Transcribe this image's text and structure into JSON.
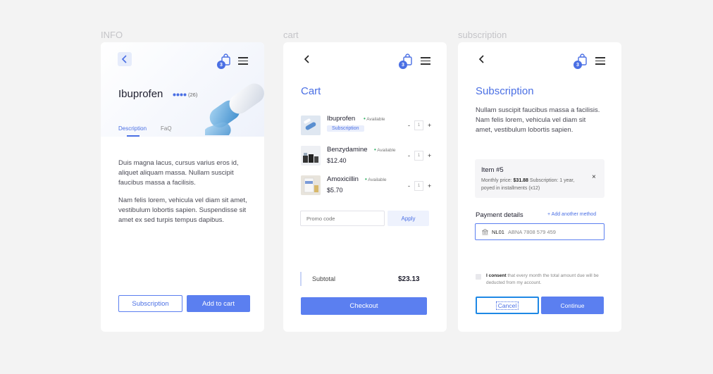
{
  "frames": {
    "info": "INFO",
    "cart": "cart",
    "subscription": "subscription"
  },
  "cart_badge_count": "3",
  "info": {
    "product_name": "Ibuprofen",
    "rating_count": "(26)",
    "tabs": [
      {
        "label": "Description"
      },
      {
        "label": "FaQ"
      }
    ],
    "description_p1": "Duis magna lacus, cursus varius eros id, aliquet aliquam massa. Nullam suscipit faucibus massa a facilisis.",
    "description_p2": "Nam felis lorem, vehicula vel diam sit amet, vestibulum lobortis sapien. Suspendisse sit amet ex sed turpis tempus dapibus.",
    "subscription_button": "Subscription",
    "add_to_cart_button": "Add to cart"
  },
  "cart": {
    "title": "Cart",
    "items": [
      {
        "name": "Ibuprofen",
        "availability": "Available",
        "tag": "Subscription",
        "qty": "1"
      },
      {
        "name": "Benzydamine",
        "availability": "Available",
        "price": "$12.40",
        "qty": "1"
      },
      {
        "name": "Amoxicillin",
        "availability": "Available",
        "price": "$5.70",
        "qty": "1"
      }
    ],
    "minus": "-",
    "plus": "+",
    "promo_placeholder": "Promo code",
    "apply_button": "Apply",
    "subtotal_label": "Subtotal",
    "subtotal_value": "$23.13",
    "checkout_button": "Checkout"
  },
  "subscription": {
    "title": "Subscription",
    "intro": "Nullam suscipit faucibus massa a facilisis. Nam felis lorem, vehicula vel diam sit amet, vestibulum lobortis sapien.",
    "item_title": "Item #5",
    "item_detail_pre": "Monthly price: ",
    "item_price": "$31.88",
    "item_detail_post": " Subscription: 1 year, poyed in installments (x12)",
    "close": "×",
    "payment_label": "Payment details",
    "add_method": "Add another method",
    "add_method_plus": "+",
    "iban_code": "NL01",
    "iban_rest": "ABNA 7808 579 459",
    "consent_bold": "I consent",
    "consent_rest": " that every month the total amount due will be deducted from my account.",
    "cancel_button": "Cancel",
    "continue_button": "Continue"
  },
  "colors": {
    "accent": "#5b7ff0",
    "accent_text": "#4a6fe4",
    "available": "#3ab56a",
    "background": "#f3f3f3"
  },
  "icons": [
    "back-arrow-icon",
    "shopping-bag-icon",
    "hamburger-menu-icon",
    "close-icon",
    "bank-icon",
    "plus-icon",
    "rating-dots-icon",
    "pill-capsule-image"
  ]
}
